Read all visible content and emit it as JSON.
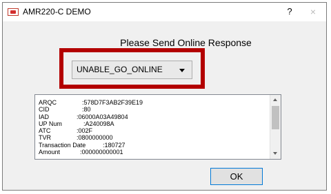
{
  "window": {
    "title": "AMR220-C DEMO",
    "help_label": "?",
    "close_label": "×"
  },
  "prompt": "Please Send Online Response",
  "response_select": {
    "selected": "UNABLE_GO_ONLINE"
  },
  "log": [
    {
      "key": "ARQC",
      "value": ":578D7F3AB2F39E19"
    },
    {
      "key": "CID",
      "value": ":80"
    },
    {
      "key": "IAD",
      "value": ":06000A03A49804"
    },
    {
      "key": "UP Num",
      "value": ":A240098A"
    },
    {
      "key": "ATC",
      "value": ":002F"
    },
    {
      "key": "TVR",
      "value": ":0800000000"
    },
    {
      "key": "Transaction Date",
      "value": ":180727"
    },
    {
      "key": "Amount",
      "value": ":000000000001"
    }
  ],
  "ok_label": "OK",
  "colors": {
    "highlight_border": "#b30000",
    "dialog_bg": "#f0f0f0",
    "ok_border": "#0078d7"
  }
}
